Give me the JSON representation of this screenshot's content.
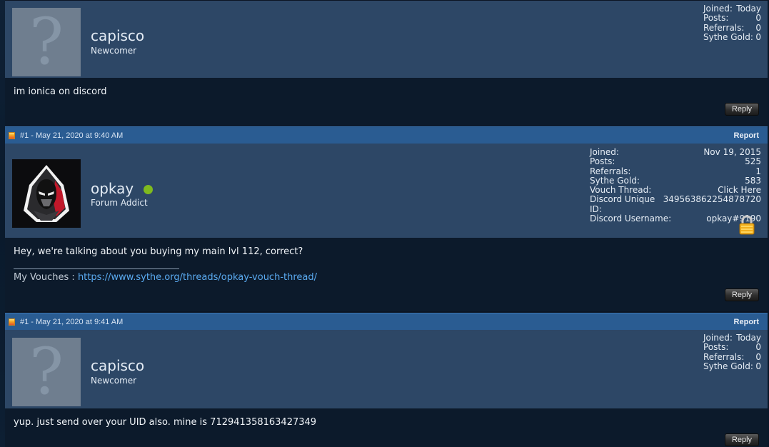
{
  "posts": [
    {
      "has_header": false,
      "username": "capisco",
      "user_title": "Newcomer",
      "online": false,
      "stats": [
        {
          "label": "Joined:",
          "value": "Today"
        },
        {
          "label": "Posts:",
          "value": "0"
        },
        {
          "label": "Referrals:",
          "value": "0"
        },
        {
          "label": "Sythe Gold:",
          "value": "0"
        }
      ],
      "message": "im ionica on discord",
      "reply_label": "Reply"
    },
    {
      "has_header": true,
      "post_date": "#1 - May 21, 2020 at 9:40 AM",
      "report_label": "Report",
      "username": "opkay",
      "user_title": "Forum Addict",
      "online": true,
      "stats": [
        {
          "label": "Joined:",
          "value": "Nov 19, 2015"
        },
        {
          "label": "Posts:",
          "value": "525"
        },
        {
          "label": "Referrals:",
          "value": "1"
        },
        {
          "label": "Sythe Gold:",
          "value": "583"
        },
        {
          "label": "Vouch Thread:",
          "value": "Click Here"
        },
        {
          "label": "Discord Unique ID:",
          "value": "349563862254878720"
        },
        {
          "label": "Discord Username:",
          "value": "opkay#9190"
        }
      ],
      "message": "Hey, we're talking about you buying my main lvl 112, correct?",
      "signature_label": "My Vouches :",
      "signature_link": "https://www.sythe.org/threads/opkay-vouch-thread/",
      "reply_label": "Reply"
    },
    {
      "has_header": true,
      "post_date": "#1 - May 21, 2020 at 9:41 AM",
      "report_label": "Report",
      "username": "capisco",
      "user_title": "Newcomer",
      "online": false,
      "stats": [
        {
          "label": "Joined:",
          "value": "Today"
        },
        {
          "label": "Posts:",
          "value": "0"
        },
        {
          "label": "Referrals:",
          "value": "0"
        },
        {
          "label": "Sythe Gold:",
          "value": "0"
        }
      ],
      "message": "yup. just send over your UID also. mine is 712941358163427349",
      "reply_label": "Reply"
    }
  ],
  "icons": {
    "post_icon": "post-status-icon",
    "avatar_default": "default-avatar-question-mark",
    "lock": "padlock-icon",
    "online": "online-status-dot"
  },
  "colors": {
    "header_bar": "#2a5c92",
    "userinfo_bg": "#2d4766",
    "message_bg": "#0c1a2b",
    "link": "#5aaaf0",
    "online": "#7fba1e"
  }
}
